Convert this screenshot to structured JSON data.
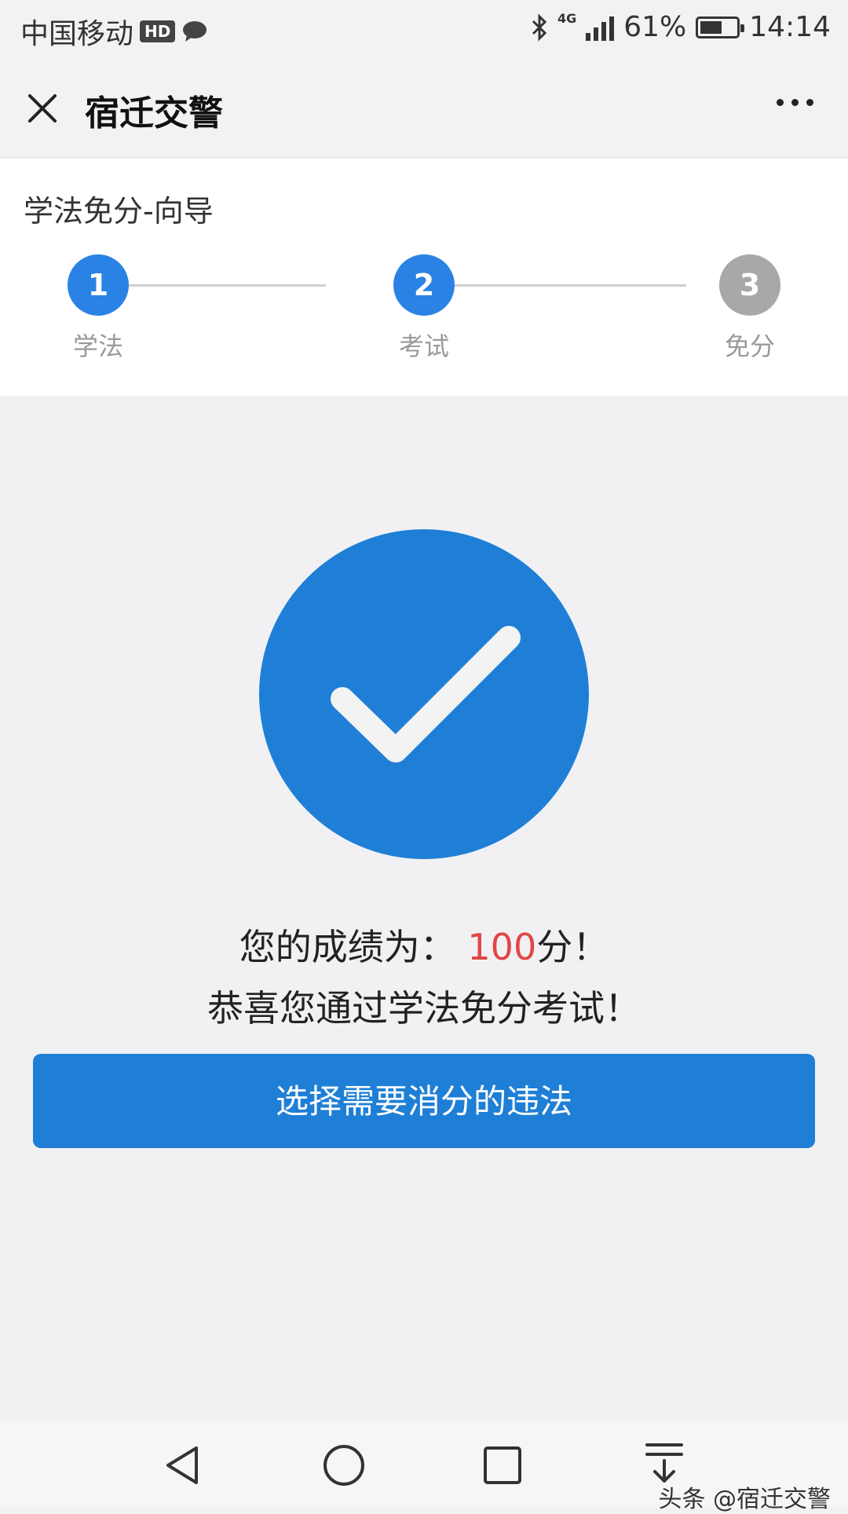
{
  "status_bar": {
    "carrier": "中国移动",
    "hd_badge": "HD",
    "network": "4G",
    "battery_percent": "61%",
    "battery_level": 0.61,
    "time": "14:14"
  },
  "nav_bar": {
    "title": "宿迁交警"
  },
  "wizard": {
    "title": "学法免分-向导",
    "steps": [
      {
        "number": "1",
        "label": "学法",
        "state": "done"
      },
      {
        "number": "2",
        "label": "考试",
        "state": "done"
      },
      {
        "number": "3",
        "label": "免分",
        "state": "pending"
      }
    ]
  },
  "result": {
    "score_prefix": "您的成绩为：",
    "score_value": "100",
    "score_suffix": "分！",
    "congrats": "恭喜您通过学法免分考试！",
    "button_label": "选择需要消分的违法"
  },
  "watermark": "头条 @宿迁交警",
  "colors": {
    "accent": "#1f7fd6",
    "step_active": "#2a82e4",
    "step_inactive": "#a8a8a8",
    "score_red": "#e24545"
  }
}
